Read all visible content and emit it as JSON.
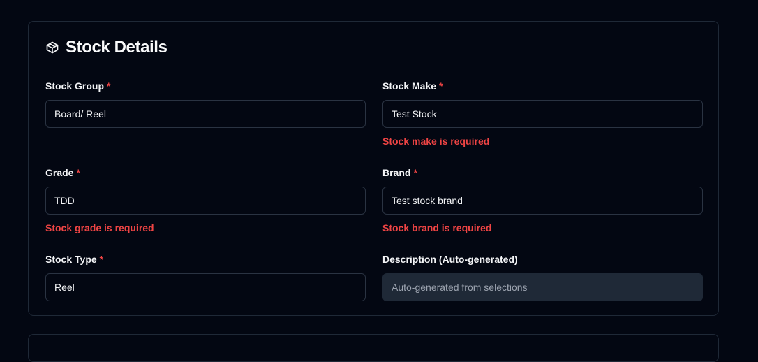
{
  "section": {
    "title": "Stock Details",
    "icon": "package-icon"
  },
  "fields": {
    "stock_group": {
      "label": "Stock Group",
      "required": "*",
      "value": "Board/ Reel"
    },
    "stock_make": {
      "label": "Stock Make",
      "required": "*",
      "value": "Test Stock",
      "error": "Stock make is required"
    },
    "grade": {
      "label": "Grade",
      "required": "*",
      "value": "TDD",
      "error": "Stock grade is required"
    },
    "brand": {
      "label": "Brand",
      "required": "*",
      "value": "Test stock brand",
      "error": "Stock brand is required"
    },
    "stock_type": {
      "label": "Stock Type",
      "required": "*",
      "value": "Reel"
    },
    "description": {
      "label": "Description (Auto-generated)",
      "placeholder": "Auto-generated from selections"
    }
  },
  "colors": {
    "background": "#030712",
    "border": "#1f2937",
    "error": "#ef4444",
    "disabled_bg": "#1f2937"
  }
}
